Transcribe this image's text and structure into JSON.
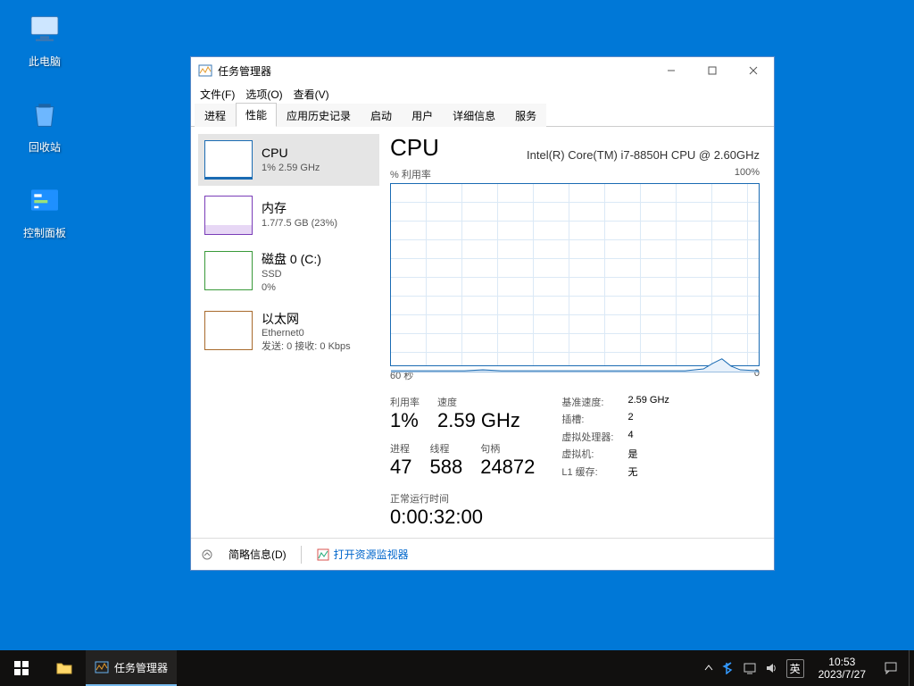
{
  "desktop": {
    "icons": [
      {
        "name": "pc-icon",
        "label": "此电脑"
      },
      {
        "name": "recycle-icon",
        "label": "回收站"
      },
      {
        "name": "control-icon",
        "label": "控制面板"
      }
    ]
  },
  "tm": {
    "title": "任务管理器",
    "menus": [
      "文件(F)",
      "选项(O)",
      "查看(V)"
    ],
    "tabs": [
      "进程",
      "性能",
      "应用历史记录",
      "启动",
      "用户",
      "详细信息",
      "服务"
    ],
    "active_tab_index": 1,
    "left": [
      {
        "kind": "cpu",
        "title": "CPU",
        "sub": "1% 2.59 GHz",
        "selected": true
      },
      {
        "kind": "mem",
        "title": "内存",
        "sub": "1.7/7.5 GB (23%)",
        "selected": false
      },
      {
        "kind": "disk",
        "title": "磁盘 0 (C:)",
        "sub": "SSD",
        "sub2": "0%",
        "selected": false
      },
      {
        "kind": "net",
        "title": "以太网",
        "sub": "Ethernet0",
        "sub2": "发送: 0 接收: 0 Kbps",
        "selected": false
      }
    ],
    "right": {
      "heading": "CPU",
      "model": "Intel(R) Core(TM) i7-8850H CPU @ 2.60GHz",
      "chart_top_left": "% 利用率",
      "chart_top_right": "100%",
      "chart_bottom_left": "60 秒",
      "chart_bottom_right": "0",
      "stats_row1": [
        {
          "label": "利用率",
          "value": "1%"
        },
        {
          "label": "速度",
          "value": "2.59 GHz"
        }
      ],
      "stats_row2": [
        {
          "label": "进程",
          "value": "47"
        },
        {
          "label": "线程",
          "value": "588"
        },
        {
          "label": "句柄",
          "value": "24872"
        }
      ],
      "stats_side": [
        {
          "label": "基准速度:",
          "value": "2.59 GHz"
        },
        {
          "label": "插槽:",
          "value": "2"
        },
        {
          "label": "虚拟处理器:",
          "value": "4"
        },
        {
          "label": "虚拟机:",
          "value": "是"
        },
        {
          "label": "L1 缓存:",
          "value": "无"
        }
      ],
      "uptime_label": "正常运行时间",
      "uptime_value": "0:00:32:00"
    },
    "footer": {
      "brief": "简略信息(D)",
      "resmon": "打开资源监视器"
    }
  },
  "taskbar": {
    "active_app": "任务管理器",
    "ime": "英",
    "time": "10:53",
    "date": "2023/7/27"
  },
  "chart_data": {
    "type": "line",
    "title": "% 利用率",
    "xlabel": "60 秒",
    "ylabel": "% 利用率",
    "x_range": [
      60,
      0
    ],
    "ylim": [
      0,
      100
    ],
    "series": [
      {
        "name": "CPU",
        "values": [
          1,
          1,
          1,
          1,
          1,
          1,
          1,
          1,
          2,
          1,
          1,
          1,
          1,
          1,
          1,
          1,
          1,
          1,
          1,
          1,
          1,
          1,
          1,
          1,
          1,
          1,
          4,
          6,
          3,
          1
        ]
      }
    ]
  }
}
